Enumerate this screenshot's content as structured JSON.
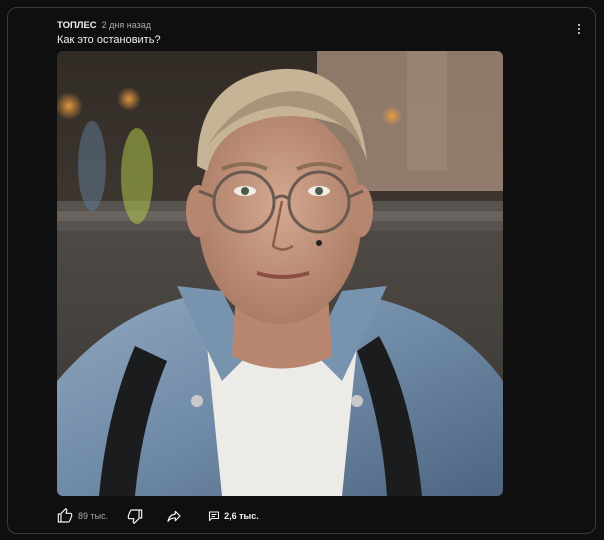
{
  "post": {
    "channel_name": "ТОПЛЕС",
    "timestamp": "2 дня назад",
    "text": "Как это остановить?",
    "image_icon": "portrait-photo"
  },
  "actions": {
    "like_count": "89 тыс.",
    "comment_count": "2,6 тыс.",
    "icons": {
      "like": "thumb-up-icon",
      "dislike": "thumb-down-icon",
      "share": "share-arrow-icon",
      "comments": "comment-lines-icon",
      "more": "more-vertical-icon"
    }
  },
  "colors": {
    "background": "#0f0f0f",
    "border": "#3a3a3a",
    "text_primary": "#f1f1f1",
    "text_secondary": "#aaaaaa"
  }
}
